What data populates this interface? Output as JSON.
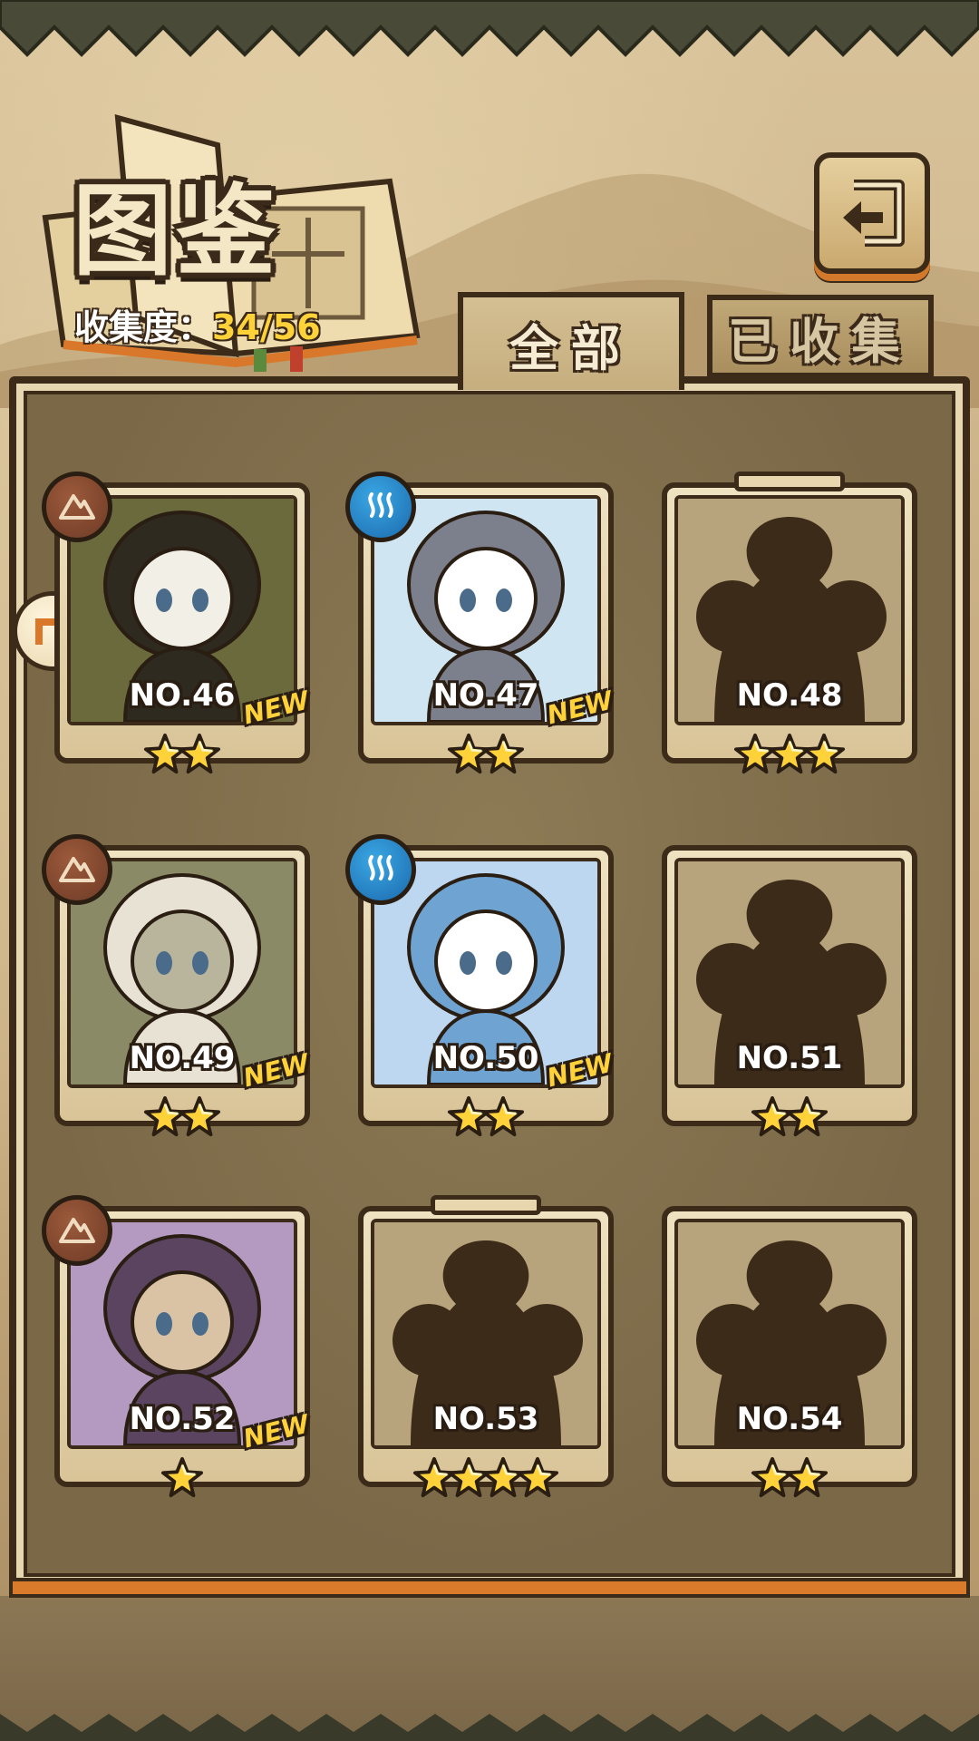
{
  "header": {
    "title": "图鉴",
    "progress_label": "收集度：",
    "progress_value": "34/56"
  },
  "tabs": [
    {
      "label": "全部",
      "selected": true
    },
    {
      "label": "已收集",
      "selected": false
    }
  ],
  "cards": [
    {
      "number": "NO.46",
      "stars": 2,
      "new": "NEW",
      "element": "earth",
      "unlocked": true
    },
    {
      "number": "NO.47",
      "stars": 2,
      "new": "NEW",
      "element": "water",
      "unlocked": true
    },
    {
      "number": "NO.48",
      "stars": 3,
      "new": "",
      "element": "",
      "unlocked": false
    },
    {
      "number": "NO.49",
      "stars": 2,
      "new": "NEW",
      "element": "earth",
      "unlocked": true
    },
    {
      "number": "NO.50",
      "stars": 2,
      "new": "NEW",
      "element": "water",
      "unlocked": true
    },
    {
      "number": "NO.51",
      "stars": 2,
      "new": "",
      "element": "",
      "unlocked": false
    },
    {
      "number": "NO.52",
      "stars": 1,
      "new": "NEW",
      "element": "earth",
      "unlocked": true
    },
    {
      "number": "NO.53",
      "stars": 4,
      "new": "",
      "element": "",
      "unlocked": false
    },
    {
      "number": "NO.54",
      "stars": 2,
      "new": "",
      "element": "",
      "unlocked": false
    }
  ],
  "colors": {
    "accent_gold": "#ffd23a",
    "outline": "#3d2b1a",
    "water": "#1b6aad",
    "earth": "#6e3b26"
  },
  "icons": {
    "back": "back-arrow-icon",
    "earth": "earth-element-icon",
    "water": "water-element-icon",
    "star": "star-icon",
    "side": "jump-arrow-icon"
  }
}
